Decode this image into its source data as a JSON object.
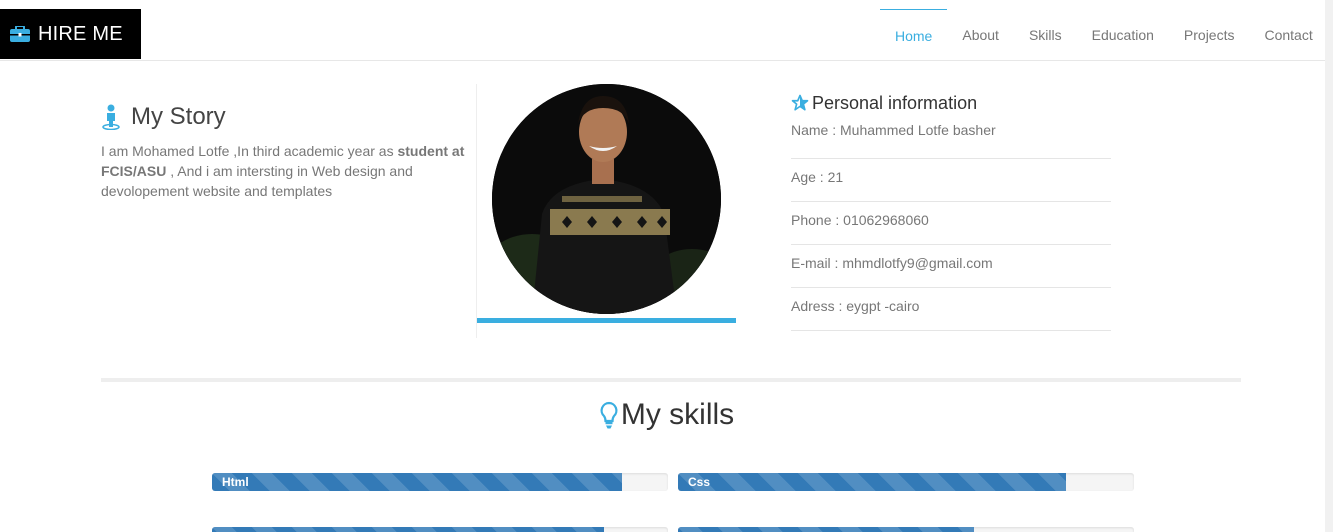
{
  "nav": {
    "brand_label": "HIRE ME",
    "brand_icon": "briefcase-icon",
    "items": [
      {
        "label": "Home",
        "active": true
      },
      {
        "label": "About",
        "active": false
      },
      {
        "label": "Skills",
        "active": false
      },
      {
        "label": "Education",
        "active": false
      },
      {
        "label": "Projects",
        "active": false
      },
      {
        "label": "Contact",
        "active": false
      }
    ]
  },
  "story": {
    "title": "My Story",
    "text_1": "I am Mohamed Lotfe ,In third academic year as ",
    "text_bold": "student at FCIS/ASU",
    "text_2": " , And i am intersting in Web design and devolopement website and templates"
  },
  "info": {
    "title": "Personal information",
    "rows": [
      "Name : Muhammed Lotfe basher",
      "Age : 21",
      "Phone : 01062968060",
      "E-mail : mhmdlotfy9@gmail.com",
      "Adress : eygpt -cairo"
    ]
  },
  "skills": {
    "title": "My skills",
    "bars": [
      {
        "label": "Html",
        "percent": 90
      },
      {
        "label": "Css",
        "percent": 85
      },
      {
        "label": "",
        "percent": 86
      },
      {
        "label": "",
        "percent": 65
      }
    ]
  },
  "colors": {
    "accent": "#3aaee0",
    "progress": "#337ab7",
    "brand_bg": "#000000"
  }
}
